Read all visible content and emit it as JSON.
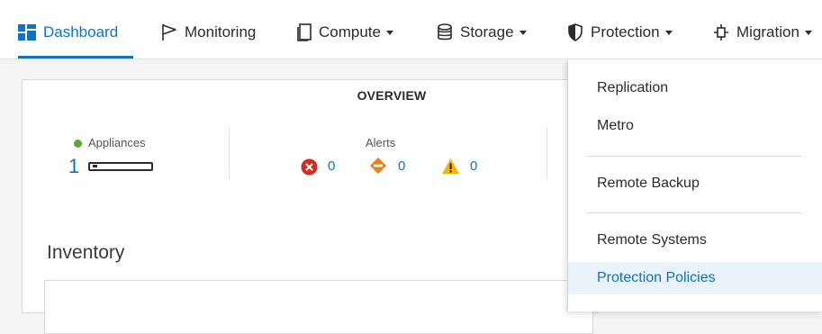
{
  "nav": {
    "items": [
      {
        "label": "Dashboard",
        "icon": "dashboard-icon",
        "has_caret": false,
        "active": true
      },
      {
        "label": "Monitoring",
        "icon": "flag-icon",
        "has_caret": false,
        "active": false
      },
      {
        "label": "Compute",
        "icon": "compute-icon",
        "has_caret": true,
        "active": false
      },
      {
        "label": "Storage",
        "icon": "storage-icon",
        "has_caret": true,
        "active": false
      },
      {
        "label": "Protection",
        "icon": "shield-icon",
        "has_caret": true,
        "active": false
      },
      {
        "label": "Migration",
        "icon": "migration-icon",
        "has_caret": true,
        "active": false
      }
    ]
  },
  "overview": {
    "title": "OVERVIEW",
    "appliances": {
      "label": "Appliances",
      "count": "1"
    },
    "alerts": {
      "label": "Alerts",
      "critical": "0",
      "major": "0",
      "minor": "0"
    }
  },
  "inventory": {
    "title": "Inventory"
  },
  "protection_menu": {
    "items": [
      {
        "label": "Replication"
      },
      {
        "label": "Metro"
      },
      {
        "label": "Remote Backup"
      },
      {
        "label": "Remote Systems"
      },
      {
        "label": "Protection Policies",
        "highlighted": true
      }
    ]
  },
  "colors": {
    "accent": "#0f72c5",
    "status_ok": "#5fa536",
    "alert_critical": "#d9281d",
    "alert_major": "#f07d18",
    "alert_minor": "#f5b400"
  }
}
